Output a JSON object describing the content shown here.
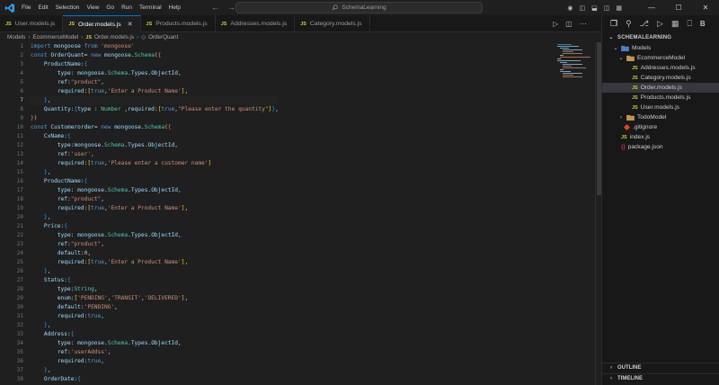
{
  "menu": [
    "File",
    "Edit",
    "Selection",
    "View",
    "Go",
    "Run",
    "Terminal",
    "Help"
  ],
  "search": {
    "text": "SchemaLearning"
  },
  "tabs": [
    {
      "label": "User.models.js",
      "badge": "JS",
      "active": false
    },
    {
      "label": "Order.models.js",
      "badge": "JS",
      "active": true
    },
    {
      "label": "Products.models.js",
      "badge": "JS",
      "active": false
    },
    {
      "label": "Addresses.models.js",
      "badge": "JS",
      "active": false
    },
    {
      "label": "Category.models.js",
      "badge": "JS",
      "active": false
    }
  ],
  "breadcrumb": {
    "part1": "Models",
    "part2": "EcommerceModel",
    "part3": "Order.models.js",
    "part4": "OrderQuant"
  },
  "gutter": {
    "current_line": 7,
    "total_lines": 39
  },
  "explorer": {
    "title": "SCHEMALEARNING",
    "items": [
      {
        "label": "Models",
        "type": "folder",
        "depth": 1,
        "open": true
      },
      {
        "label": "EcommerceModel",
        "type": "folder",
        "depth": 2,
        "open": true
      },
      {
        "label": "Addresses.models.js",
        "type": "js",
        "depth": 3
      },
      {
        "label": "Category.models.js",
        "type": "js",
        "depth": 3
      },
      {
        "label": "Order.models.js",
        "type": "js",
        "depth": 3,
        "selected": true
      },
      {
        "label": "Products.models.js",
        "type": "js",
        "depth": 3
      },
      {
        "label": "User.models.js",
        "type": "js",
        "depth": 3
      },
      {
        "label": "TodoModel",
        "type": "folder",
        "depth": 2,
        "open": false
      },
      {
        "label": ".gitignore",
        "type": "git",
        "depth": 1
      },
      {
        "label": "index.js",
        "type": "js",
        "depth": 1
      },
      {
        "label": "package.json",
        "type": "json",
        "depth": 1
      }
    ]
  },
  "panels": {
    "outline": "OUTLINE",
    "timeline": "TIMELINE"
  },
  "colors": {
    "accent": "#0078d4",
    "js_badge": "#cbcb41",
    "background": "#1f1f1f",
    "sidebar": "#181818"
  }
}
